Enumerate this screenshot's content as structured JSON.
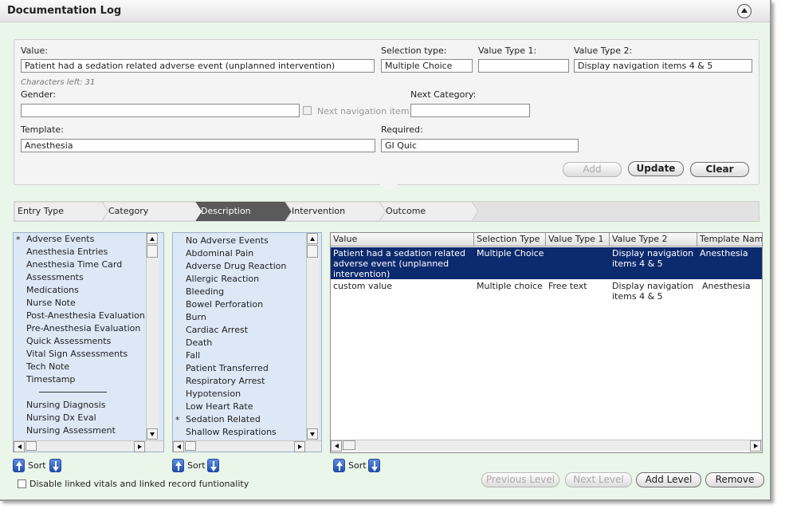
{
  "window": {
    "title": "Documentation Log"
  },
  "form": {
    "value_label": "Value:",
    "value": "Patient had a sedation related adverse event (unplanned intervention)",
    "chars_left": "Characters left: 31",
    "selection_type_label": "Selection type:",
    "selection_type": "Multiple Choice",
    "value_type1_label": "Value Type 1:",
    "value_type1": "",
    "value_type2_label": "Value Type 2:",
    "value_type2": "Display navigation items 4 & 5",
    "gender_label": "Gender:",
    "gender": "",
    "next_nav_label": "Next navigation item",
    "next_category_label": "Next Category:",
    "next_category": "",
    "template_label": "Template:",
    "template": "Anesthesia",
    "required_label": "Required:",
    "required": "GI Quic",
    "add_label": "Add",
    "update_label": "Update",
    "clear_label": "Clear"
  },
  "breadcrumb": [
    "Entry Type",
    "Category",
    "Description",
    "Intervention",
    "Outcome"
  ],
  "entry_list": [
    {
      "label": "Adverse Events",
      "mark": "*"
    },
    {
      "label": "Anesthesia Entries",
      "mark": ""
    },
    {
      "label": "Anesthesia Time Card",
      "mark": ""
    },
    {
      "label": "Assessments",
      "mark": ""
    },
    {
      "label": "Medications",
      "mark": ""
    },
    {
      "label": "Nurse Note",
      "mark": ""
    },
    {
      "label": "Post-Anesthesia Evaluation",
      "mark": ""
    },
    {
      "label": "Pre-Anesthesia Evaluation",
      "mark": ""
    },
    {
      "label": "Quick Assessments",
      "mark": ""
    },
    {
      "label": "Vital Sign Assessments",
      "mark": ""
    },
    {
      "label": "Tech Note",
      "mark": ""
    },
    {
      "label": "Timestamp",
      "mark": ""
    },
    {
      "label": "",
      "mark": "",
      "separator": true
    },
    {
      "label": "Nursing Diagnosis",
      "mark": ""
    },
    {
      "label": "Nursing Dx Eval",
      "mark": ""
    },
    {
      "label": "Nursing Assessment",
      "mark": ""
    }
  ],
  "category_list": [
    {
      "label": "No Adverse Events",
      "mark": ""
    },
    {
      "label": "Abdominal Pain",
      "mark": ""
    },
    {
      "label": "Adverse Drug Reaction",
      "mark": ""
    },
    {
      "label": "Allergic Reaction",
      "mark": ""
    },
    {
      "label": "Bleeding",
      "mark": ""
    },
    {
      "label": "Bowel Perforation",
      "mark": ""
    },
    {
      "label": "Burn",
      "mark": ""
    },
    {
      "label": "Cardiac Arrest",
      "mark": ""
    },
    {
      "label": "Death",
      "mark": ""
    },
    {
      "label": "Fall",
      "mark": ""
    },
    {
      "label": "Patient Transferred",
      "mark": ""
    },
    {
      "label": "Respiratory Arrest",
      "mark": ""
    },
    {
      "label": "Hypotension",
      "mark": ""
    },
    {
      "label": "Low Heart Rate",
      "mark": ""
    },
    {
      "label": "Sedation Related",
      "mark": "*"
    },
    {
      "label": "Shallow Respirations",
      "mark": ""
    }
  ],
  "grid": {
    "columns": [
      "Value",
      "Selection Type",
      "Value Type 1",
      "Value Type 2",
      "Template Name"
    ],
    "rows": [
      [
        "Patient had a sedation related adverse event (unplanned intervention)",
        "Multiple Choice",
        "",
        "Display navigation items 4 & 5",
        "Anesthesia"
      ],
      [
        "custom value",
        "Multiple choice",
        "Free text",
        "Display navigation items 4 & 5",
        "Anesthesia"
      ]
    ]
  },
  "sort_label": "Sort",
  "footer": {
    "disable_linked_label": "Disable linked vitals and linked record funtionality",
    "previous_level_label": "Previous Level",
    "next_level_label": "Next Level",
    "add_level_label": "Add Level",
    "remove_label": "Remove"
  }
}
